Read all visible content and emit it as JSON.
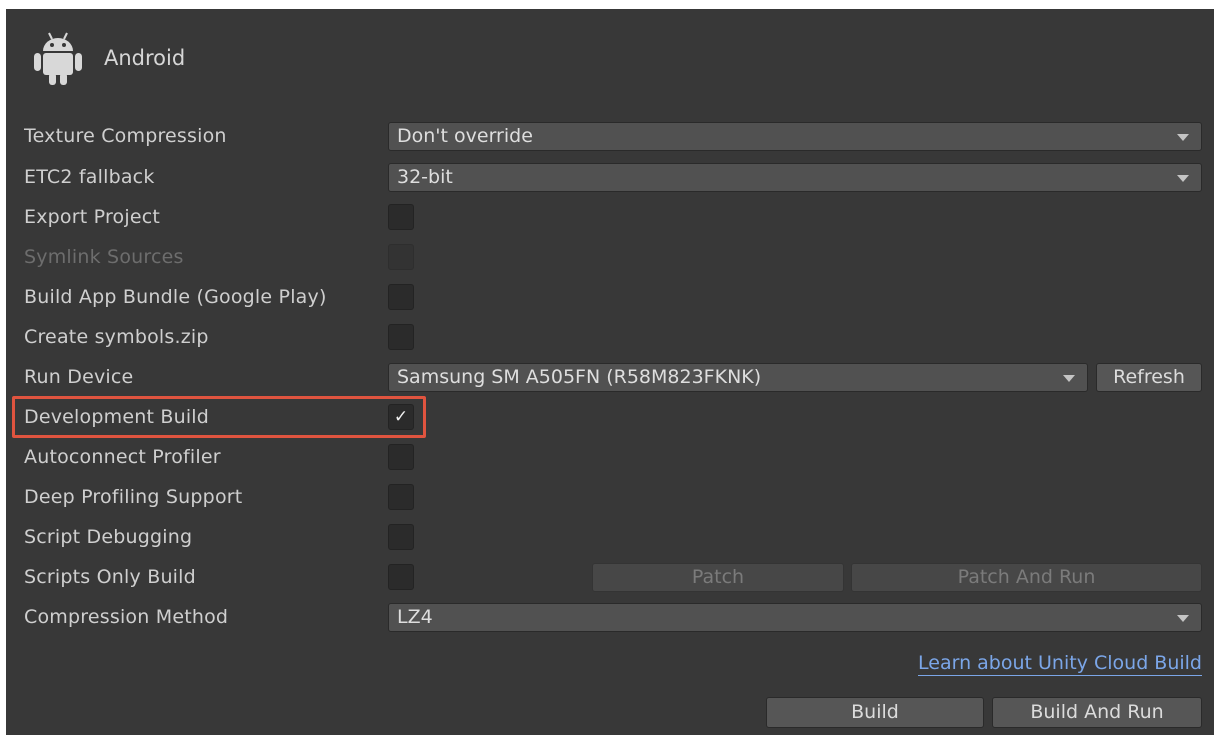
{
  "header": {
    "platform_icon": "android-icon",
    "title": "Android"
  },
  "settings": {
    "texture_compression": {
      "label": "Texture Compression",
      "value": "Don't override"
    },
    "etc2_fallback": {
      "label": "ETC2 fallback",
      "value": "32-bit"
    },
    "export_project": {
      "label": "Export Project",
      "checked": false
    },
    "symlink_sources": {
      "label": "Symlink Sources",
      "checked": false,
      "disabled": true
    },
    "build_app_bundle": {
      "label": "Build App Bundle (Google Play)",
      "checked": false
    },
    "create_symbols_zip": {
      "label": "Create symbols.zip",
      "checked": false
    },
    "run_device": {
      "label": "Run Device",
      "value": "Samsung SM A505FN (R58M823FKNK)",
      "refresh_label": "Refresh"
    },
    "development_build": {
      "label": "Development Build",
      "checked": true,
      "check_glyph": "✓"
    },
    "autoconnect_profiler": {
      "label": "Autoconnect Profiler",
      "checked": false
    },
    "deep_profiling": {
      "label": "Deep Profiling Support",
      "checked": false
    },
    "script_debugging": {
      "label": "Script Debugging",
      "checked": false
    },
    "scripts_only_build": {
      "label": "Scripts Only Build",
      "checked": false,
      "patch_label": "Patch",
      "patch_and_run_label": "Patch And Run"
    },
    "compression_method": {
      "label": "Compression Method",
      "value": "LZ4"
    }
  },
  "footer": {
    "cloud_build_link": "Learn about Unity Cloud Build",
    "build_label": "Build",
    "build_and_run_label": "Build And Run"
  },
  "colors": {
    "panel_background": "#383838",
    "highlight_border": "#e0543f",
    "link": "#7ba6e8"
  }
}
